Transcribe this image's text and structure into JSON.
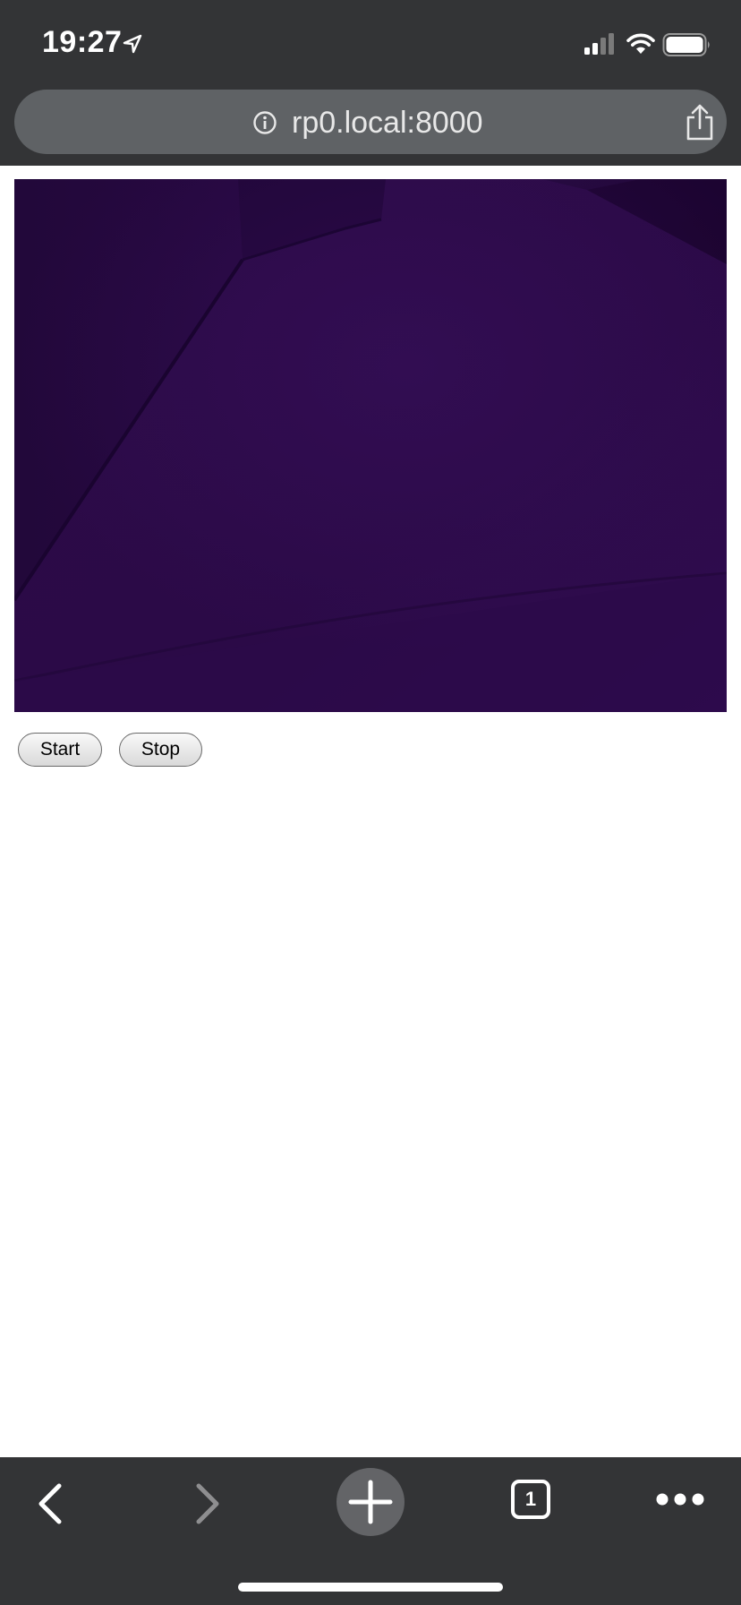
{
  "status_bar": {
    "time": "19:27",
    "icons": [
      "location-arrow-icon",
      "cellular-signal-icon",
      "wifi-icon",
      "battery-icon"
    ]
  },
  "browser": {
    "url": "rp0.local:8000",
    "tab_count": "1",
    "icons": [
      "info-icon",
      "share-icon",
      "back-icon",
      "forward-icon",
      "new-tab-icon",
      "tab-switcher-icon",
      "more-icon"
    ]
  },
  "page": {
    "start_label": "Start",
    "stop_label": "Stop"
  },
  "colors": {
    "chrome": "#333436",
    "url_pill": "#5f6265",
    "feed": "#27093f"
  }
}
